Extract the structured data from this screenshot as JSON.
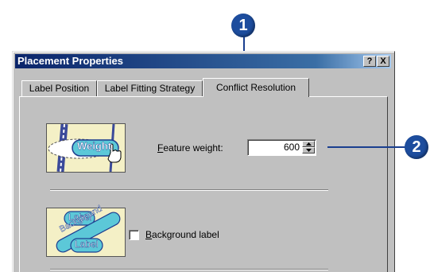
{
  "window": {
    "title": "Placement Properties",
    "help_button": "?",
    "close_button": "X"
  },
  "tabs": [
    {
      "label": "Label Position"
    },
    {
      "label": "Label Fitting Strategy"
    },
    {
      "label": "Conflict Resolution",
      "active": true
    }
  ],
  "feature_weight": {
    "image_text": "Weight",
    "label_accesskey": "F",
    "label_rest": "eature weight:",
    "value": "600"
  },
  "background_label": {
    "image_texts": [
      "Label",
      "Background",
      "Label"
    ],
    "label_accesskey": "B",
    "label_rest": "ackground label",
    "checked": false
  },
  "callouts": [
    {
      "number": "1"
    },
    {
      "number": "2"
    }
  ],
  "colors": {
    "callout": "#1d4d9e",
    "titlebar_start": "#0a246a",
    "dialog_face": "#c0c0c0",
    "image_bg": "#f4f0c6",
    "label_fill": "#5cc8d8"
  }
}
